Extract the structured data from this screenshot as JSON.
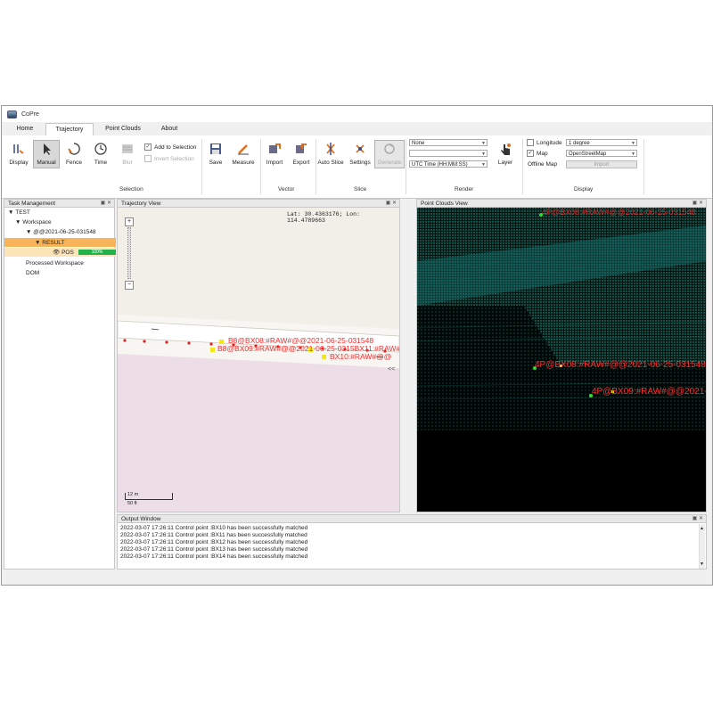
{
  "window": {
    "title": "CoPre"
  },
  "tabs": [
    "Home",
    "Trajectory",
    "Point Clouds",
    "About"
  ],
  "ribbon": {
    "display": "Display",
    "manual": "Manual",
    "fence": "Fence",
    "time": "Time",
    "blur": "Blur",
    "add_to_selection": "Add to Selection",
    "invert_selection": "Invert Selection",
    "selection_group": "Selection",
    "save": "Save",
    "measure": "Measure",
    "import": "Import",
    "export": "Export",
    "vector_group": "Vector",
    "auto_slice": "Auto Slice",
    "settings": "Settings",
    "generate": "Generate",
    "slice_group": "Slice",
    "render_select1": "None",
    "render_select2": "",
    "render_select3": "UTC Time (HH:MM:SS)",
    "layer": "Layer",
    "render_group": "Render",
    "longitude_label": "Longitude",
    "longitude_value": "1 degree",
    "map_label": "Map",
    "map_value": "OpenStreetMap",
    "offline_map": "Offline Map",
    "import_btn": "Import",
    "display_group": "Display"
  },
  "task_panel": {
    "title": "Task Management",
    "tree": {
      "root": "TEST",
      "workspace": "Workspace",
      "dataset": "@@2021-06-25-031548",
      "result": "RESULT",
      "pos": "POS",
      "progress_text": "100%",
      "progress": 1.0,
      "processed": "Processed Workspace",
      "dom": "DOM"
    }
  },
  "trajectory_view": {
    "title": "Trajectory View",
    "coords": "Lat: 30.4363176; Lon: 114.4789663",
    "labels": [
      "B8@BX08:#RAW#@@2021-06-25-031548",
      "B8@BX09:#RAW#@@2021-06-25-0315BX11:#RAW#@@",
      "BX10:#RAW#@@"
    ],
    "scale_m": "12 m",
    "scale_ft": "50 ft",
    "zoom_in": "+",
    "zoom_out": "−",
    "collapse": "<<"
  },
  "point_cloud_view": {
    "title": "Point Clouds View",
    "labels": [
      "4P@BX08:#RAW#@@2021-06-25-031548",
      "4P@BX08:#RAW#@@2021-06-25-031548",
      "4P@BX09:#RAW#@@2021-06-2"
    ]
  },
  "output_window": {
    "title": "Output Window",
    "lines": [
      "2022-03-07 17:26:11  Control point :BX10 has been successfully matched",
      "2022-03-07 17:26:11  Control point :BX11 has been successfully matched",
      "2022-03-07 17:26:11  Control point :BX12 has been successfully matched",
      "2022-03-07 17:26:11  Control point :BX13 has been successfully matched",
      "2022-03-07 17:26:11  Control point :BX14 has been successfully matched"
    ]
  },
  "colors": {
    "accent": "#f7b45a",
    "progress": "#22b24c",
    "pc_point": "#1fa8a0",
    "label": "#ff3030"
  }
}
